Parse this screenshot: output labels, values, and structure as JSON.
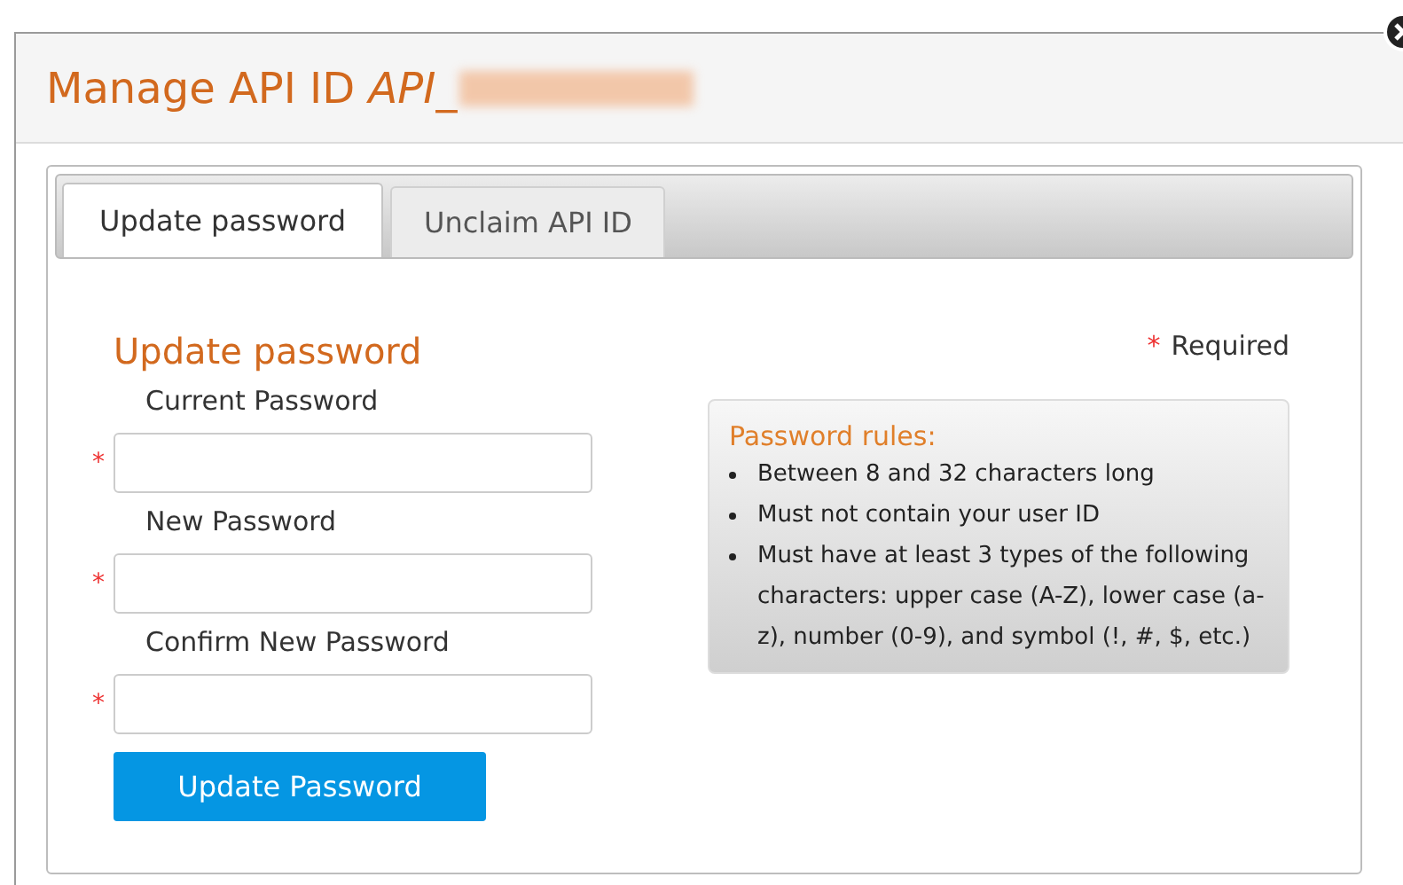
{
  "dialog": {
    "title": "Manage API ID",
    "title_id": "API_"
  },
  "tabs": [
    {
      "label": "Update password",
      "selected": true
    },
    {
      "label": "Unclaim API ID",
      "selected": false
    }
  ],
  "form": {
    "heading": "Update password",
    "required_mark": "*",
    "required_note": "Required",
    "fields": [
      {
        "label": "Current Password",
        "required": true
      },
      {
        "label": "New Password",
        "required": true
      },
      {
        "label": "Confirm New Password",
        "required": true
      }
    ],
    "submit": "Update Password"
  },
  "rules": {
    "title": "Password rules:",
    "items": [
      "Between 8 and 32 characters long",
      "Must not contain your user ID",
      "Must have at least 3 types of the following characters: upper case (A-Z), lower case (a-z), number (0-9), and symbol (!, #, $, etc.)"
    ]
  }
}
